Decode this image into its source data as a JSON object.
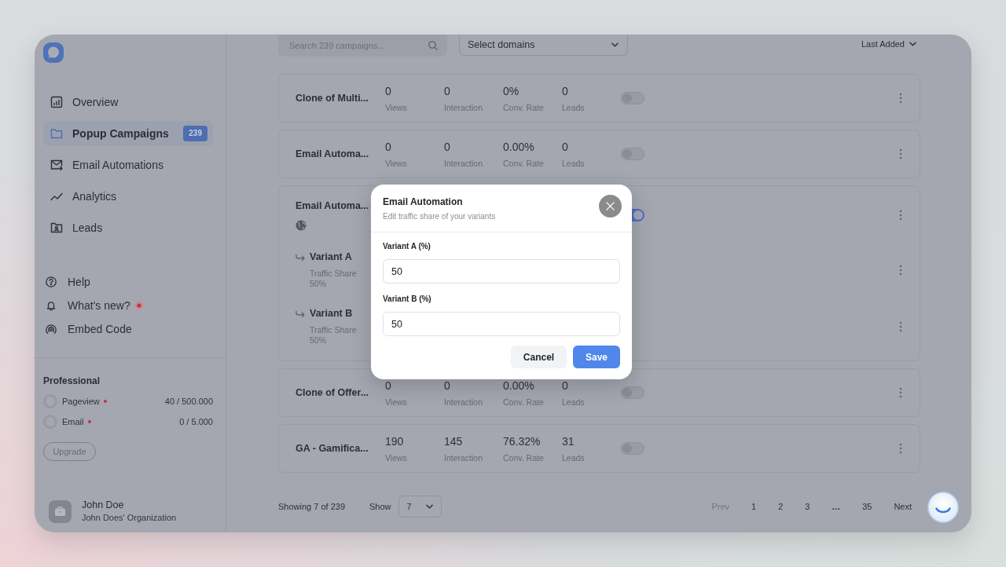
{
  "sidebar": {
    "nav_items": [
      {
        "label": "Overview",
        "selected": false
      },
      {
        "label": "Popup Campaigns",
        "selected": true,
        "badge": "239"
      },
      {
        "label": "Email Automations",
        "selected": false
      },
      {
        "label": "Analytics",
        "selected": false
      },
      {
        "label": "Leads",
        "selected": false
      }
    ],
    "secondary_items": [
      {
        "label": "Help",
        "dot": false
      },
      {
        "label": "What's new?",
        "dot": true
      },
      {
        "label": "Embed Code",
        "dot": false
      }
    ],
    "plan": {
      "name": "Professional",
      "usage": [
        {
          "label": "Pageview",
          "alert": true,
          "level": 0,
          "value": "40 / 500.000"
        },
        {
          "label": "Email",
          "alert": true,
          "level": 0,
          "value": "0 / 5.000"
        }
      ],
      "upgrade_button": "Upgrade"
    },
    "user": {
      "name": "John Doe",
      "organization": "John Does' Organization"
    }
  },
  "toolbar": {
    "search": {
      "placeholder": "Search 239 campaigns..."
    },
    "domain_select": {
      "value": "Select domains"
    },
    "sort": {
      "value": "Last Added"
    }
  },
  "campaigns": [
    {
      "kind": "single",
      "name": "Clone of Multi...",
      "on": false,
      "stats": [
        {
          "value": "0",
          "label": "Views"
        },
        {
          "value": "0",
          "label": "Interaction"
        },
        {
          "value": "0%",
          "label": "Conv. Rate"
        },
        {
          "value": "0",
          "label": "Leads"
        }
      ]
    },
    {
      "kind": "single",
      "name": "Email Automa...",
      "on": false,
      "stats": [
        {
          "value": "0",
          "label": "Views"
        },
        {
          "value": "0",
          "label": "Interaction"
        },
        {
          "value": "0.00%",
          "label": "Conv. Rate"
        },
        {
          "value": "0",
          "label": "Leads"
        }
      ]
    },
    {
      "kind": "split",
      "name": "Email Automa...",
      "on": true,
      "variants": [
        {
          "name": "Variant A",
          "caption": "Traffic Share",
          "share": "50%"
        },
        {
          "name": "Variant B",
          "caption": "Traffic Share",
          "share": "50%"
        }
      ]
    },
    {
      "kind": "single",
      "name": "Clone of Offer...",
      "on": false,
      "stats": [
        {
          "value": "0",
          "label": "Views"
        },
        {
          "value": "0",
          "label": "Interaction"
        },
        {
          "value": "0.00%",
          "label": "Conv. Rate"
        },
        {
          "value": "0",
          "label": "Leads"
        }
      ]
    },
    {
      "kind": "single",
      "name": "GA - Gamifica...",
      "on": false,
      "stats": [
        {
          "value": "190",
          "label": "Views"
        },
        {
          "value": "145",
          "label": "Interaction"
        },
        {
          "value": "76.32%",
          "label": "Conv. Rate"
        },
        {
          "value": "31",
          "label": "Leads"
        }
      ]
    }
  ],
  "pagination": {
    "summary": "Showing 7 of 239",
    "page_size_label": "Show",
    "page_size": "7",
    "prev": {
      "label": "Prev",
      "disabled": true
    },
    "pages": [
      {
        "kind": "page",
        "label": "1"
      },
      {
        "kind": "page",
        "label": "2"
      },
      {
        "kind": "page",
        "label": "3"
      },
      {
        "kind": "ellipsis",
        "label": "..."
      },
      {
        "kind": "page",
        "label": "35"
      }
    ],
    "next": {
      "label": "Next",
      "disabled": false
    }
  },
  "modal": {
    "title": "Email Automation",
    "subtitle": "Edit traffic share of your variants",
    "fields": [
      {
        "label": "Variant A (%)",
        "value": "50"
      },
      {
        "label": "Variant B (%)",
        "value": "50"
      }
    ],
    "buttons": [
      {
        "kind": "secondary",
        "label": "Cancel"
      },
      {
        "kind": "primary",
        "label": "Save"
      }
    ]
  }
}
